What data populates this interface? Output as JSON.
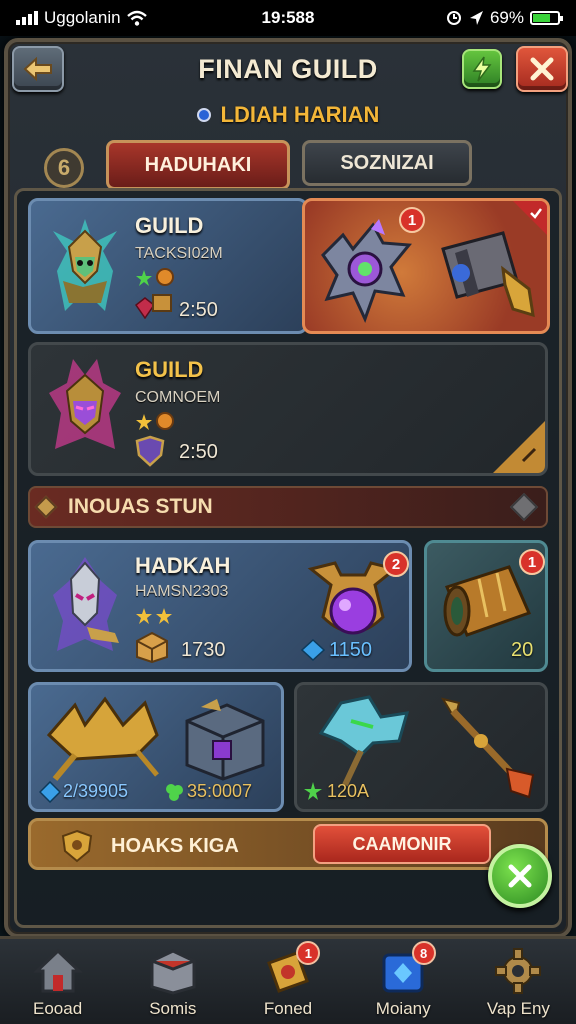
{
  "status_bar": {
    "carrier": "Uggolanin",
    "time": "19:588",
    "battery": "69%",
    "battery_level": 0.69
  },
  "header": {
    "title": "FINAN GUILD",
    "back_icon": "arrow-left-icon",
    "bolt_icon": "lightning-icon",
    "close_icon": "close-icon"
  },
  "subtitle": "LDIAH HARIAN",
  "tabs": {
    "badge_value": "6",
    "active_label": "HADUHAKI",
    "inactive_label": "SOZNIZAI"
  },
  "cards": [
    {
      "name": "GUILD",
      "subtitle": "TACKSI02M",
      "time": "2:50",
      "reward_badge": "1"
    },
    {
      "name": "GUILD",
      "subtitle": "COMNOEM",
      "time": "2:50"
    }
  ],
  "section_title": "INOUAS STUN",
  "shop": {
    "hero": {
      "name": "HADKAH",
      "subtitle": "HAMSN2303",
      "price": "1730",
      "potion_price": "1150",
      "potion_badge": "2"
    },
    "cannon": {
      "price": "20",
      "badge": "1"
    },
    "crown_item": {
      "price": "2/39905"
    },
    "chest_item": {
      "price": "35:0007"
    },
    "axe_item": {
      "price": "120A"
    }
  },
  "bottom_bar": {
    "label": "HOAKS KIGA",
    "button": "CAAMONIR"
  },
  "nav": [
    {
      "label": "Eooad",
      "icon": "home-icon"
    },
    {
      "label": "Somis",
      "icon": "chest-icon"
    },
    {
      "label": "Foned",
      "icon": "scroll-icon",
      "badge": "1"
    },
    {
      "label": "Moiany",
      "icon": "gem-box-icon",
      "badge": "8"
    },
    {
      "label": "Vap Eny",
      "icon": "gear-icon"
    }
  ],
  "colors": {
    "accent_gold": "#f3b638",
    "panel_border": "#5a5142",
    "red_button": "#c43325",
    "green_button": "#3fae2e"
  }
}
